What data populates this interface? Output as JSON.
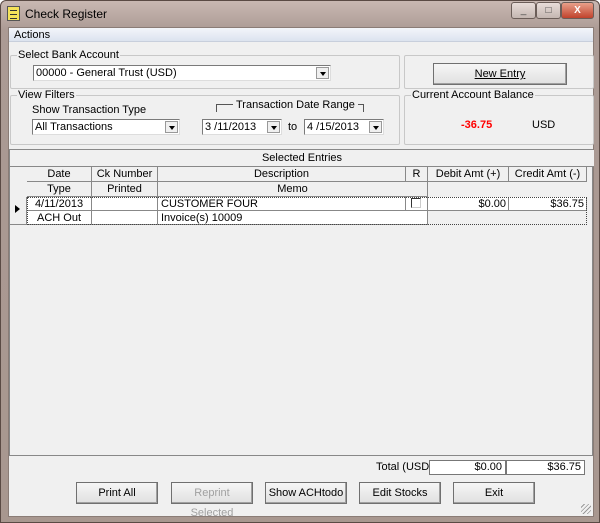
{
  "window": {
    "title": "Check Register",
    "minimize": "_",
    "maximize": "□",
    "close": "X"
  },
  "menu": {
    "actions": "Actions"
  },
  "bank_account": {
    "label": "Select Bank Account",
    "value": "00000 - General Trust (USD)"
  },
  "new_entry": "New Entry",
  "filters": {
    "label": "View Filters",
    "type_label": "Show Transaction Type",
    "type_value": "All Transactions",
    "range_label": "Transaction Date Range",
    "from": "3 /11/2013",
    "to_label": "to",
    "to": "4 /15/2013"
  },
  "balance": {
    "label": "Current Account Balance",
    "value": "-36.75",
    "currency": "USD",
    "value_color": "#ff0000"
  },
  "grid": {
    "title": "Selected Entries",
    "headers1": [
      "Date",
      "Ck Number",
      "Description",
      "R",
      "Debit Amt (+)",
      "Credit Amt (-)"
    ],
    "headers2": [
      "Type",
      "Printed",
      "Memo"
    ],
    "rows": [
      {
        "date": "4/11/2013",
        "ck_number": "",
        "description": "CUSTOMER FOUR",
        "reconciled": false,
        "debit": "$0.00",
        "credit": "$36.75",
        "type": "ACH Out",
        "printed": "",
        "memo": "Invoice(s) 10009"
      }
    ]
  },
  "totals": {
    "label": "Total (USD)",
    "debit": "$0.00",
    "credit": "$36.75"
  },
  "buttons": {
    "print_all": "Print All",
    "reprint": "Reprint Selected",
    "show_ach": "Show ACHtodo",
    "edit_stocks": "Edit Stocks",
    "exit": "Exit"
  }
}
